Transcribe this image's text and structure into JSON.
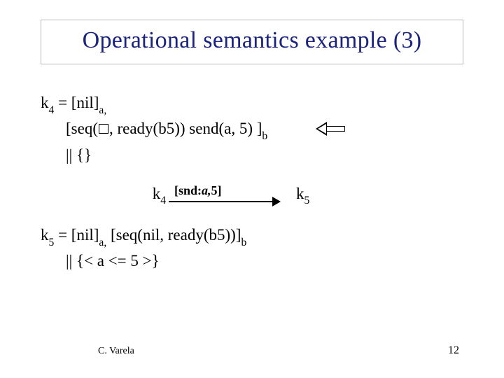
{
  "title": "Operational semantics example (3)",
  "k4": {
    "line1_prefix": "k",
    "line1_sub": "4",
    "line1_eq": " = [nil]",
    "line1_sub_a": "a,",
    "line2_a": "[seq(",
    "line2_b": ", ready(b5))  send(a, 5)  ]",
    "line2_sub_b": "b",
    "line3": "||  {}"
  },
  "transition": {
    "left_k": "k",
    "left_sub": "4",
    "label_prefix": "[snd:",
    "label_ital": "a,",
    "label_suffix": "5]",
    "right_k": "k",
    "right_sub": "5"
  },
  "k5": {
    "line1_prefix": "k",
    "line1_sub": "5",
    "line1_mid": " = [nil]",
    "line1_sub_a": "a,",
    "line1_rest": " [seq(nil, ready(b5))]",
    "line1_sub_b": "b",
    "line2": "||  {< a <= 5 >}"
  },
  "footer": {
    "author": "C. Varela",
    "page": "12"
  }
}
